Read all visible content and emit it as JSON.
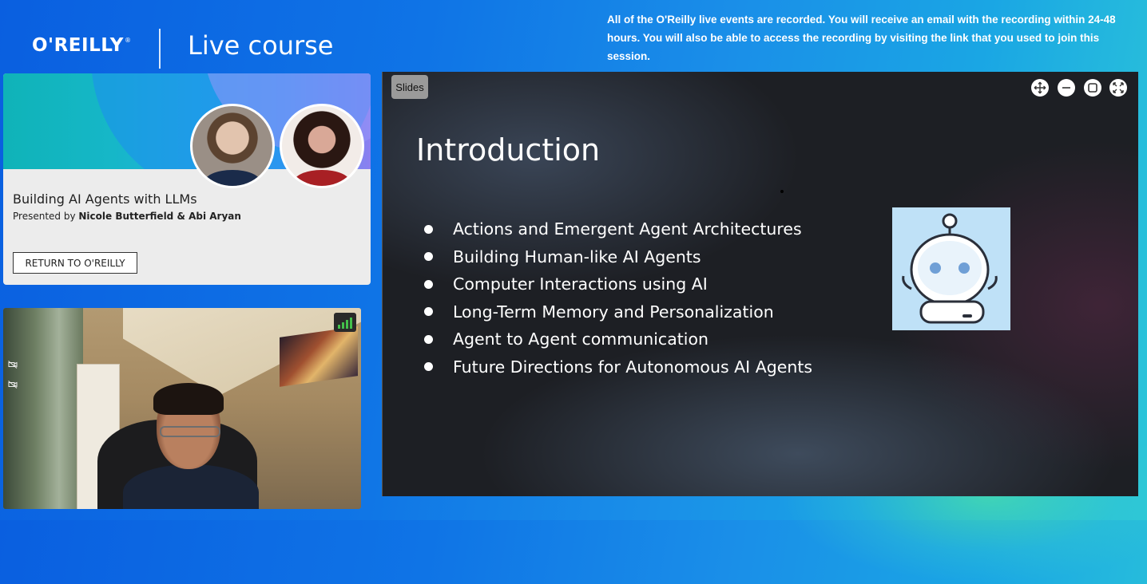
{
  "header": {
    "brand": "O'REILLY",
    "brand_mark": "®",
    "course_label": "Live course",
    "notice": "All of the O'Reilly live events are recorded. You will receive an email with the recording within 24-48 hours. You will also be able to access the recording by visiting the link that you used to join this session."
  },
  "course_card": {
    "title": "Building AI Agents with LLMs",
    "presented_by_prefix": "Presented by ",
    "presenters": "Nicole Butterfield & Abi Aryan",
    "return_button": "RETURN TO O'REILLY"
  },
  "webcam": {
    "signal_icon": "signal-bars-icon",
    "side_icons": [
      "camera-off-icon",
      "camera-off-icon"
    ]
  },
  "slides": {
    "tag": "Slides",
    "controls": [
      "move-icon",
      "minimize-icon",
      "restore-icon",
      "fullscreen-icon"
    ],
    "title": "Introduction",
    "bullets": [
      "Actions and Emergent Agent Architectures",
      "Building Human-like AI Agents",
      "Computer Interactions using AI",
      "Long-Term Memory and Personalization",
      "Agent to Agent communication",
      "Future Directions for Autonomous AI Agents"
    ],
    "image": "robot-mascot-icon"
  },
  "colors": {
    "background_start": "#0a5fe0",
    "background_end": "#2cc6d8",
    "slide_background": "#1d1f24",
    "card_background": "#ececec",
    "signal_green": "#43c04b"
  }
}
